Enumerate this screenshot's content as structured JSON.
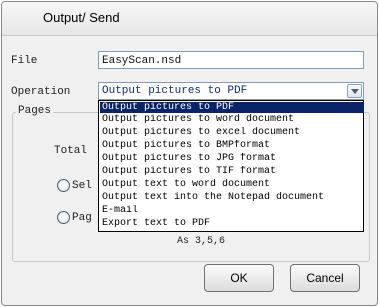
{
  "dialog": {
    "title": "Output/ Send"
  },
  "file": {
    "label": "File",
    "value": "EasyScan.nsd"
  },
  "operation": {
    "label": "Operation",
    "selected": "Output pictures to PDF",
    "options": [
      "Output pictures to PDF",
      "Output pictures to word document",
      "Output pictures to excel document",
      "Output pictures to BMPformat",
      "Output pictures to JPG format",
      "Output pictures to TIF format",
      "Output text to word document",
      "Output text into the Notepad document",
      "E-mail",
      "Export text to PDF"
    ]
  },
  "pages": {
    "group_label": "Pages",
    "total_label": "Total",
    "radio_selected_label": "Sel",
    "radio_pages_label": "Pag",
    "hint": "As 3,5,6"
  },
  "buttons": {
    "ok": "OK",
    "cancel": "Cancel"
  }
}
